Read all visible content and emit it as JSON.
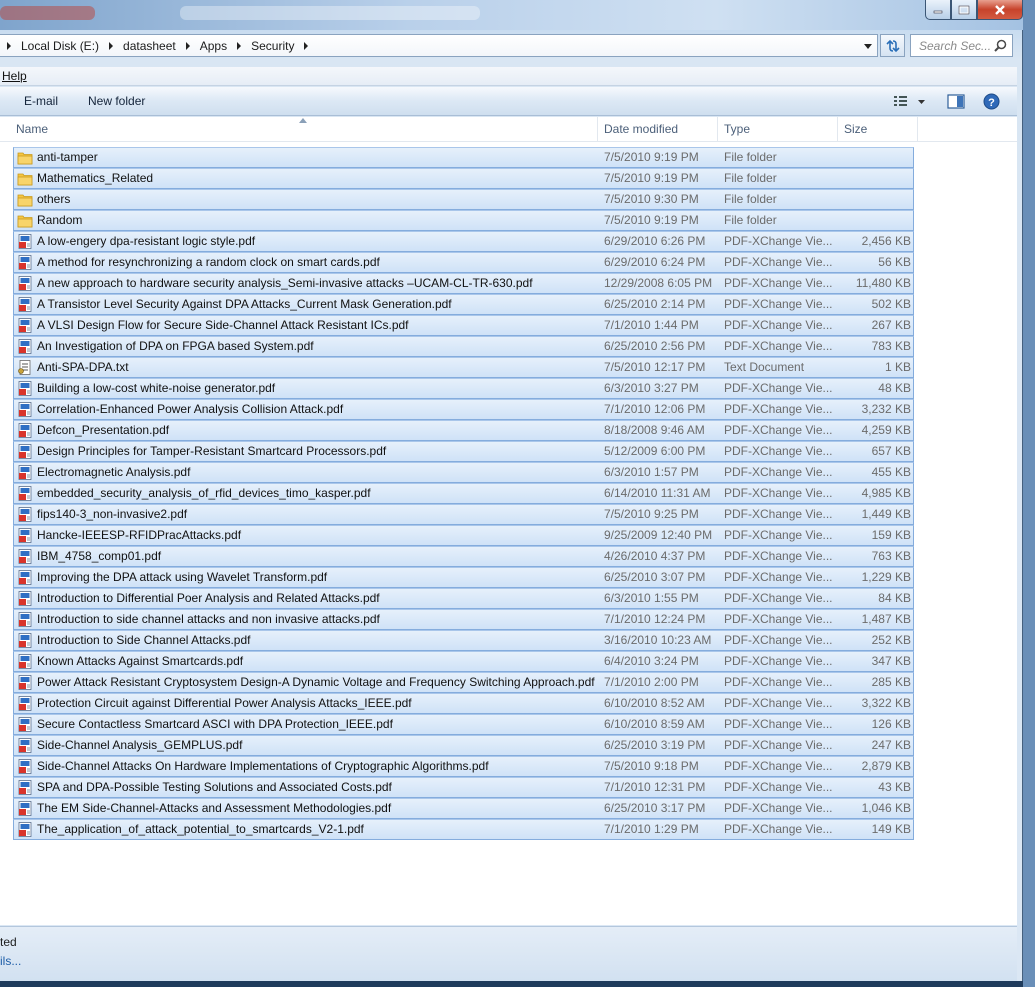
{
  "address": {
    "crumbs": [
      "Local Disk (E:)",
      "datasheet",
      "Apps",
      "Security"
    ],
    "search_placeholder": "Search Sec..."
  },
  "menu": {
    "help": "Help"
  },
  "toolbar": {
    "email": "E-mail",
    "new_folder": "New folder"
  },
  "columns": {
    "name": "Name",
    "date": "Date modified",
    "type": "Type",
    "size": "Size"
  },
  "files": [
    {
      "icon": "folder",
      "name": "anti-tamper",
      "date": "7/5/2010 9:19 PM",
      "type": "File folder",
      "size": ""
    },
    {
      "icon": "folder",
      "name": "Mathematics_Related",
      "date": "7/5/2010 9:19 PM",
      "type": "File folder",
      "size": ""
    },
    {
      "icon": "folder",
      "name": "others",
      "date": "7/5/2010 9:30 PM",
      "type": "File folder",
      "size": ""
    },
    {
      "icon": "folder",
      "name": "Random",
      "date": "7/5/2010 9:19 PM",
      "type": "File folder",
      "size": ""
    },
    {
      "icon": "pdf",
      "name": "A low-engery dpa-resistant logic style.pdf",
      "date": "6/29/2010 6:26 PM",
      "type": "PDF-XChange Vie...",
      "size": "2,456 KB"
    },
    {
      "icon": "pdf",
      "name": "A method for resynchronizing a random clock on smart cards.pdf",
      "date": "6/29/2010 6:24 PM",
      "type": "PDF-XChange Vie...",
      "size": "56 KB"
    },
    {
      "icon": "pdf",
      "name": "A new approach to hardware security analysis_Semi-invasive attacks –UCAM-CL-TR-630.pdf",
      "date": "12/29/2008 6:05 PM",
      "type": "PDF-XChange Vie...",
      "size": "11,480 KB"
    },
    {
      "icon": "pdf",
      "name": "A Transistor Level Security Against DPA Attacks_Current Mask Generation.pdf",
      "date": "6/25/2010 2:14 PM",
      "type": "PDF-XChange Vie...",
      "size": "502 KB"
    },
    {
      "icon": "pdf",
      "name": "A VLSI Design Flow for Secure Side-Channel Attack Resistant ICs.pdf",
      "date": "7/1/2010 1:44 PM",
      "type": "PDF-XChange Vie...",
      "size": "267 KB"
    },
    {
      "icon": "pdf",
      "name": "An Investigation of DPA on FPGA based System.pdf",
      "date": "6/25/2010 2:56 PM",
      "type": "PDF-XChange Vie...",
      "size": "783 KB"
    },
    {
      "icon": "txt",
      "name": "Anti-SPA-DPA.txt",
      "date": "7/5/2010 12:17 PM",
      "type": "Text Document",
      "size": "1 KB"
    },
    {
      "icon": "pdf",
      "name": "Building a low-cost white-noise generator.pdf",
      "date": "6/3/2010 3:27 PM",
      "type": "PDF-XChange Vie...",
      "size": "48 KB"
    },
    {
      "icon": "pdf",
      "name": "Correlation-Enhanced Power Analysis Collision Attack.pdf",
      "date": "7/1/2010 12:06 PM",
      "type": "PDF-XChange Vie...",
      "size": "3,232 KB"
    },
    {
      "icon": "pdf",
      "name": "Defcon_Presentation.pdf",
      "date": "8/18/2008 9:46 AM",
      "type": "PDF-XChange Vie...",
      "size": "4,259 KB"
    },
    {
      "icon": "pdf",
      "name": "Design Principles for Tamper-Resistant Smartcard Processors.pdf",
      "date": "5/12/2009 6:00 PM",
      "type": "PDF-XChange Vie...",
      "size": "657 KB"
    },
    {
      "icon": "pdf",
      "name": "Electromagnetic Analysis.pdf",
      "date": "6/3/2010 1:57 PM",
      "type": "PDF-XChange Vie...",
      "size": "455 KB"
    },
    {
      "icon": "pdf",
      "name": "embedded_security_analysis_of_rfid_devices_timo_kasper.pdf",
      "date": "6/14/2010 11:31 AM",
      "type": "PDF-XChange Vie...",
      "size": "4,985 KB"
    },
    {
      "icon": "pdf",
      "name": "fips140-3_non-invasive2.pdf",
      "date": "7/5/2010 9:25 PM",
      "type": "PDF-XChange Vie...",
      "size": "1,449 KB"
    },
    {
      "icon": "pdf",
      "name": "Hancke-IEEESP-RFIDPracAttacks.pdf",
      "date": "9/25/2009 12:40 PM",
      "type": "PDF-XChange Vie...",
      "size": "159 KB"
    },
    {
      "icon": "pdf",
      "name": "IBM_4758_comp01.pdf",
      "date": "4/26/2010 4:37 PM",
      "type": "PDF-XChange Vie...",
      "size": "763 KB"
    },
    {
      "icon": "pdf",
      "name": "Improving the DPA attack using Wavelet Transform.pdf",
      "date": "6/25/2010 3:07 PM",
      "type": "PDF-XChange Vie...",
      "size": "1,229 KB"
    },
    {
      "icon": "pdf",
      "name": "Introduction to Differential Poer Analysis and Related Attacks.pdf",
      "date": "6/3/2010 1:55 PM",
      "type": "PDF-XChange Vie...",
      "size": "84 KB"
    },
    {
      "icon": "pdf",
      "name": "Introduction to side channel attacks and non invasive attacks.pdf",
      "date": "7/1/2010 12:24 PM",
      "type": "PDF-XChange Vie...",
      "size": "1,487 KB"
    },
    {
      "icon": "pdf",
      "name": "Introduction to Side Channel Attacks.pdf",
      "date": "3/16/2010 10:23 AM",
      "type": "PDF-XChange Vie...",
      "size": "252 KB"
    },
    {
      "icon": "pdf",
      "name": "Known Attacks Against Smartcards.pdf",
      "date": "6/4/2010 3:24 PM",
      "type": "PDF-XChange Vie...",
      "size": "347 KB"
    },
    {
      "icon": "pdf",
      "name": "Power Attack Resistant Cryptosystem Design-A Dynamic Voltage and Frequency Switching Approach.pdf",
      "date": "7/1/2010 2:00 PM",
      "type": "PDF-XChange Vie...",
      "size": "285 KB"
    },
    {
      "icon": "pdf",
      "name": "Protection Circuit against Differential Power Analysis Attacks_IEEE.pdf",
      "date": "6/10/2010 8:52 AM",
      "type": "PDF-XChange Vie...",
      "size": "3,322 KB"
    },
    {
      "icon": "pdf",
      "name": "Secure Contactless Smartcard ASCI with DPA Protection_IEEE.pdf",
      "date": "6/10/2010 8:59 AM",
      "type": "PDF-XChange Vie...",
      "size": "126 KB"
    },
    {
      "icon": "pdf",
      "name": "Side-Channel Analysis_GEMPLUS.pdf",
      "date": "6/25/2010 3:19 PM",
      "type": "PDF-XChange Vie...",
      "size": "247 KB"
    },
    {
      "icon": "pdf",
      "name": "Side-Channel Attacks On Hardware Implementations of Cryptographic Algorithms.pdf",
      "date": "7/5/2010 9:18 PM",
      "type": "PDF-XChange Vie...",
      "size": "2,879 KB"
    },
    {
      "icon": "pdf",
      "name": "SPA and DPA-Possible Testing Solutions and Associated Costs.pdf",
      "date": "7/1/2010 12:31 PM",
      "type": "PDF-XChange Vie...",
      "size": "43 KB"
    },
    {
      "icon": "pdf",
      "name": "The EM Side-Channel-Attacks and Assessment Methodologies.pdf",
      "date": "6/25/2010 3:17 PM",
      "type": "PDF-XChange Vie...",
      "size": "1,046 KB"
    },
    {
      "icon": "pdf",
      "name": "The_application_of_attack_potential_to_smartcards_V2-1.pdf",
      "date": "7/1/2010 1:29 PM",
      "type": "PDF-XChange Vie...",
      "size": "149 KB"
    }
  ],
  "status": {
    "count_text": "ted",
    "details_link": "ils..."
  }
}
